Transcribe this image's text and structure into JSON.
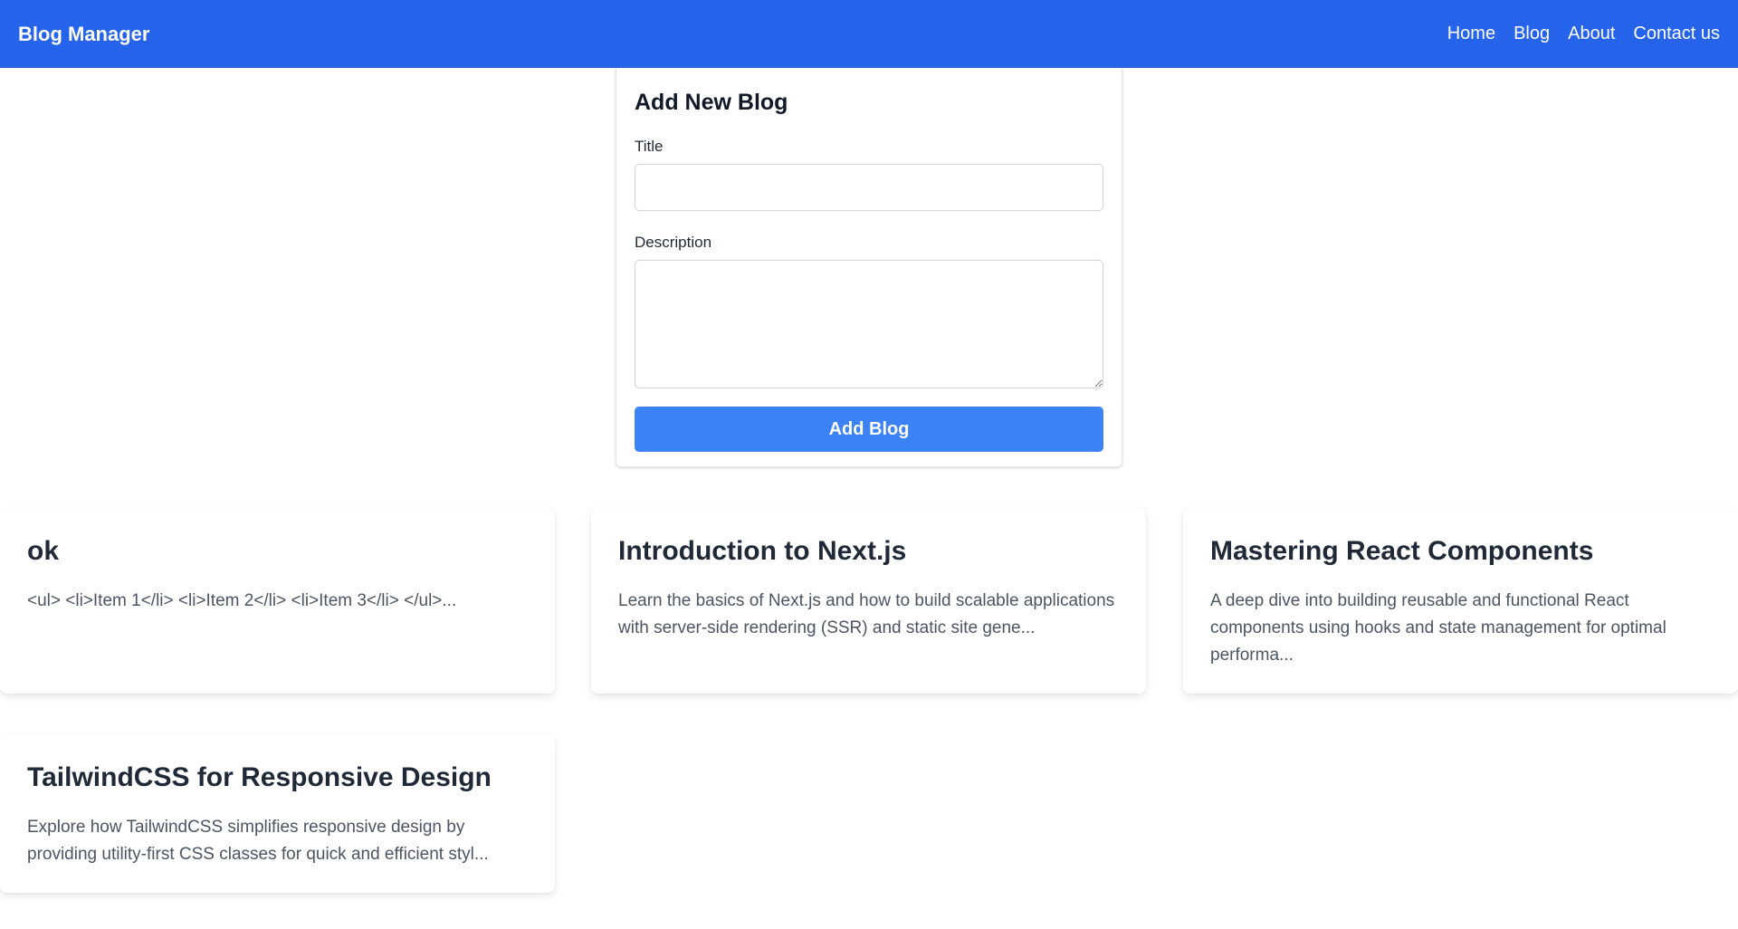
{
  "navbar": {
    "brand": "Blog Manager",
    "links": [
      "Home",
      "Blog",
      "About",
      "Contact us"
    ]
  },
  "form": {
    "heading": "Add New Blog",
    "title_label": "Title",
    "title_value": "",
    "title_placeholder": "",
    "description_label": "Description",
    "description_value": "",
    "description_placeholder": "",
    "submit_label": "Add Blog"
  },
  "blogs": [
    {
      "title": "ok",
      "description": "<ul> <li>Item 1</li> <li>Item 2</li> <li>Item 3</li> </ul>..."
    },
    {
      "title": "Introduction to Next.js",
      "description": "Learn the basics of Next.js and how to build scalable applications with server-side rendering (SSR) and static site gene..."
    },
    {
      "title": "Mastering React Components",
      "description": "A deep dive into building reusable and functional React components using hooks and state management for optimal performa..."
    },
    {
      "title": "TailwindCSS for Responsive Design",
      "description": "Explore how TailwindCSS simplifies responsive design by providing utility-first CSS classes for quick and efficient styl..."
    }
  ],
  "colors": {
    "navbar_bg": "#2563eb",
    "button_bg": "#3b82f6",
    "card_title": "#1f2937",
    "card_text": "#4b5563"
  }
}
